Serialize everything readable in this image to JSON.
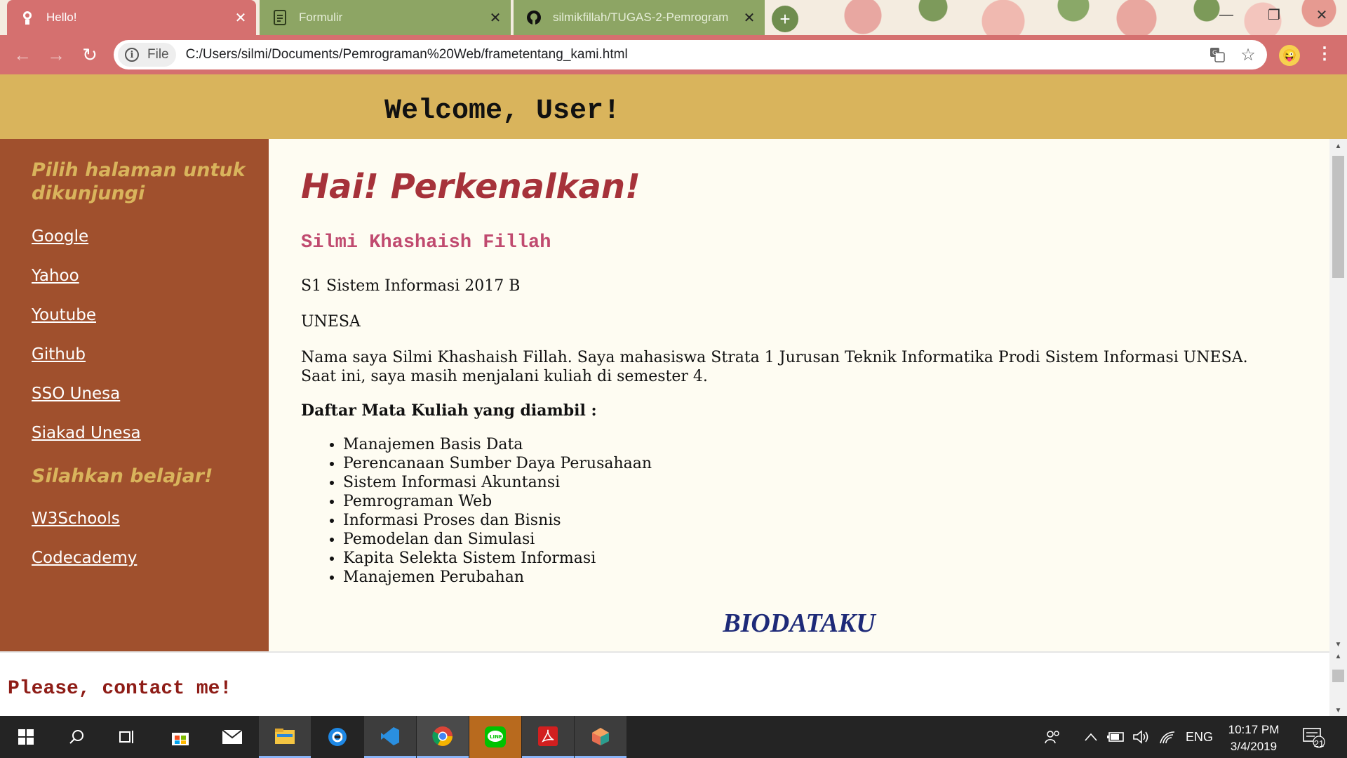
{
  "browser": {
    "tabs": [
      {
        "title": "Hello!",
        "active": true
      },
      {
        "title": "Formulir",
        "active": false
      },
      {
        "title": "silmikfillah/TUGAS-2-Pemrogram",
        "active": false
      }
    ],
    "address": {
      "chip_label": "File",
      "url": "C:/Users/silmi/Documents/Pemrograman%20Web/frametentang_kami.html"
    }
  },
  "header": {
    "welcome": "Welcome, User!"
  },
  "sidebar": {
    "heading1": "Pilih halaman untuk dikunjungi",
    "links1": [
      "Google",
      "Yahoo",
      "Youtube",
      "Github",
      "SSO Unesa",
      "Siakad Unesa"
    ],
    "heading2": "Silahkan belajar!",
    "links2": [
      "W3Schools",
      "Codecademy"
    ]
  },
  "content": {
    "title": "Hai! Perkenalkan!",
    "name": "Silmi Khashaish Fillah",
    "program": "S1 Sistem Informasi 2017 B",
    "university": "UNESA",
    "intro_line1": "Nama saya Silmi Khashaish Fillah. Saya mahasiswa Strata 1 Jurusan Teknik Informatika Prodi Sistem Informasi UNESA.",
    "intro_line2": "Saat ini, saya masih menjalani kuliah di semester 4.",
    "courses_heading": "Daftar Mata Kuliah yang diambil :",
    "courses": [
      "Manajemen Basis Data",
      "Perencanaan Sumber Daya Perusahaan",
      "Sistem Informasi Akuntansi",
      "Pemrograman Web",
      "Informasi Proses dan Bisnis",
      "Pemodelan dan Simulasi",
      "Kapita Selekta Sistem Informasi",
      "Manajemen Perubahan"
    ],
    "biodata_heading": "BIODATAKU"
  },
  "footer": {
    "text": "Please, contact me!"
  },
  "taskbar": {
    "tray_language": "ENG",
    "time": "10:17 PM",
    "date": "3/4/2019",
    "notification_count": "21"
  },
  "colors": {
    "tab_active": "#d5706f",
    "tab_inactive": "#8da564",
    "header_bg": "#d9b45c",
    "sidebar_bg": "#a0502d",
    "content_bg": "#fefcf2",
    "title_color": "#a6323a",
    "name_color": "#c04a6f",
    "biodata_color": "#1e2a78",
    "footer_text": "#8e1c16"
  }
}
